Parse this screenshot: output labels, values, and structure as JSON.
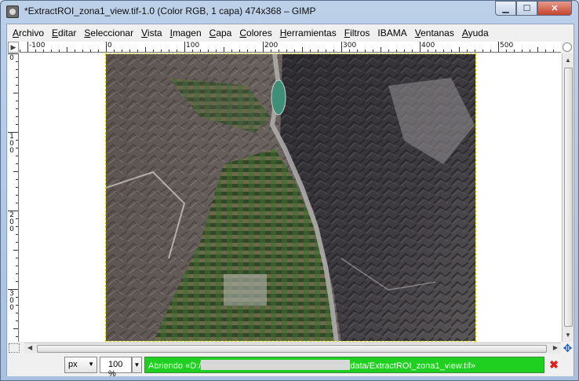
{
  "window": {
    "title": "*ExtractROI_zona1_view.tif-1.0 (Color RGB, 1 capa) 474x368 – GIMP",
    "buttons": {
      "minimize": "▁",
      "maximize": "☐",
      "close": "✕"
    }
  },
  "menubar": {
    "items": [
      {
        "first": "A",
        "rest": "rchivo"
      },
      {
        "first": "E",
        "rest": "ditar"
      },
      {
        "first": "S",
        "rest": "eleccionar"
      },
      {
        "first": "V",
        "rest": "ista"
      },
      {
        "first": "I",
        "rest": "magen"
      },
      {
        "first": "C",
        "rest": "apa"
      },
      {
        "first": "C",
        "rest": "olores"
      },
      {
        "first": "H",
        "rest": "erramientas"
      },
      {
        "first": "F",
        "rest": "iltros"
      },
      {
        "first": "",
        "rest": "IBAMA"
      },
      {
        "first": "V",
        "rest": "entanas"
      },
      {
        "first": "A",
        "rest": "yuda"
      }
    ]
  },
  "rulers": {
    "corner_icon": "▶",
    "horizontal_labels": [
      "-100",
      "0",
      "100",
      "200",
      "300",
      "400",
      "500"
    ],
    "vertical_labels": [
      "0",
      "100",
      "200",
      "300"
    ]
  },
  "statusbar": {
    "unit": "px",
    "zoom": "100 %",
    "progress_prefix": "Abriendo «D:/",
    "progress_suffix": "data/ExtractROI_zona1_view.tif»",
    "cancel_icon": "✖"
  },
  "icons": {
    "scroll_up": "▲",
    "scroll_down": "▼",
    "scroll_left": "◀",
    "scroll_right": "▶",
    "navigate": "✥",
    "dropdown": "▼"
  }
}
